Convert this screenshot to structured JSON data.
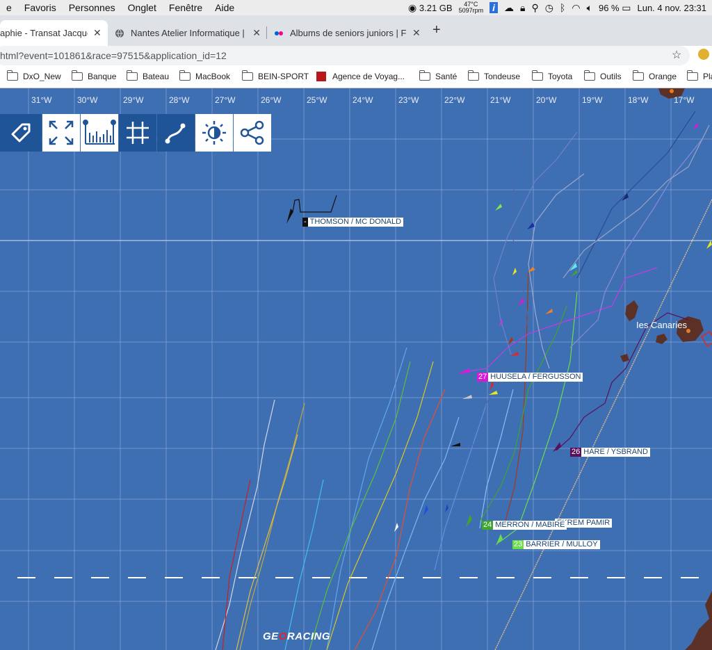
{
  "menubar": {
    "items": [
      "e",
      "Favoris",
      "Personnes",
      "Onglet",
      "Fenêtre",
      "Aide"
    ],
    "memory": "3.21 GB",
    "temp": "47°C",
    "rpm": "5097rpm",
    "battery": "96 %",
    "clock": "Lun. 4 nov.  23:31"
  },
  "tabs": [
    {
      "title": "aphie - Transat Jacque",
      "active": true
    },
    {
      "title": "Nantes Atelier Informatique | U",
      "active": false
    },
    {
      "title": "Albums de seniors juniors | Flic",
      "active": false
    }
  ],
  "address": {
    "url": "html?event=101861&race=97515&application_id=12"
  },
  "bookmarks": [
    "DxO_New",
    "Banque",
    "Bateau",
    "MacBook",
    "BEIN-SPORT",
    "Agence de Voyag...",
    "Santé",
    "Tondeuse",
    "Toyota",
    "Outils",
    "Orange",
    "Pla"
  ],
  "map": {
    "longitude_labels": [
      "31°W",
      "30°W",
      "29°W",
      "28°W",
      "27°W",
      "26°W",
      "25°W",
      "24°W",
      "23°W",
      "22°W",
      "21°W",
      "20°W",
      "19°W",
      "18°W",
      "17°W"
    ],
    "toolbar": [
      "tag-icon",
      "expand-icon",
      "chart-icon",
      "grid-icon",
      "route-icon",
      "brightness-icon",
      "share-icon"
    ],
    "place_label": "Ies Canaries",
    "boats": [
      {
        "num": "-",
        "name": "THOMSON / MC DONALD",
        "color": "#111111"
      },
      {
        "num": "27",
        "name": "HUUSELA / FERGUSSON",
        "color": "#d61ad6"
      },
      {
        "num": "26",
        "name": "HARE / YSBRAND",
        "color": "#5a0f5a"
      },
      {
        "num": "",
        "name": "EKREM PAMIR",
        "color": "#ffffff"
      },
      {
        "num": "24",
        "name": "MERRON / MABIRE",
        "color": "#3fa52e"
      },
      {
        "num": "23",
        "name": "BARRIER / MULLOY",
        "color": "#6bdc4a"
      }
    ],
    "logo": "GEORACING"
  }
}
